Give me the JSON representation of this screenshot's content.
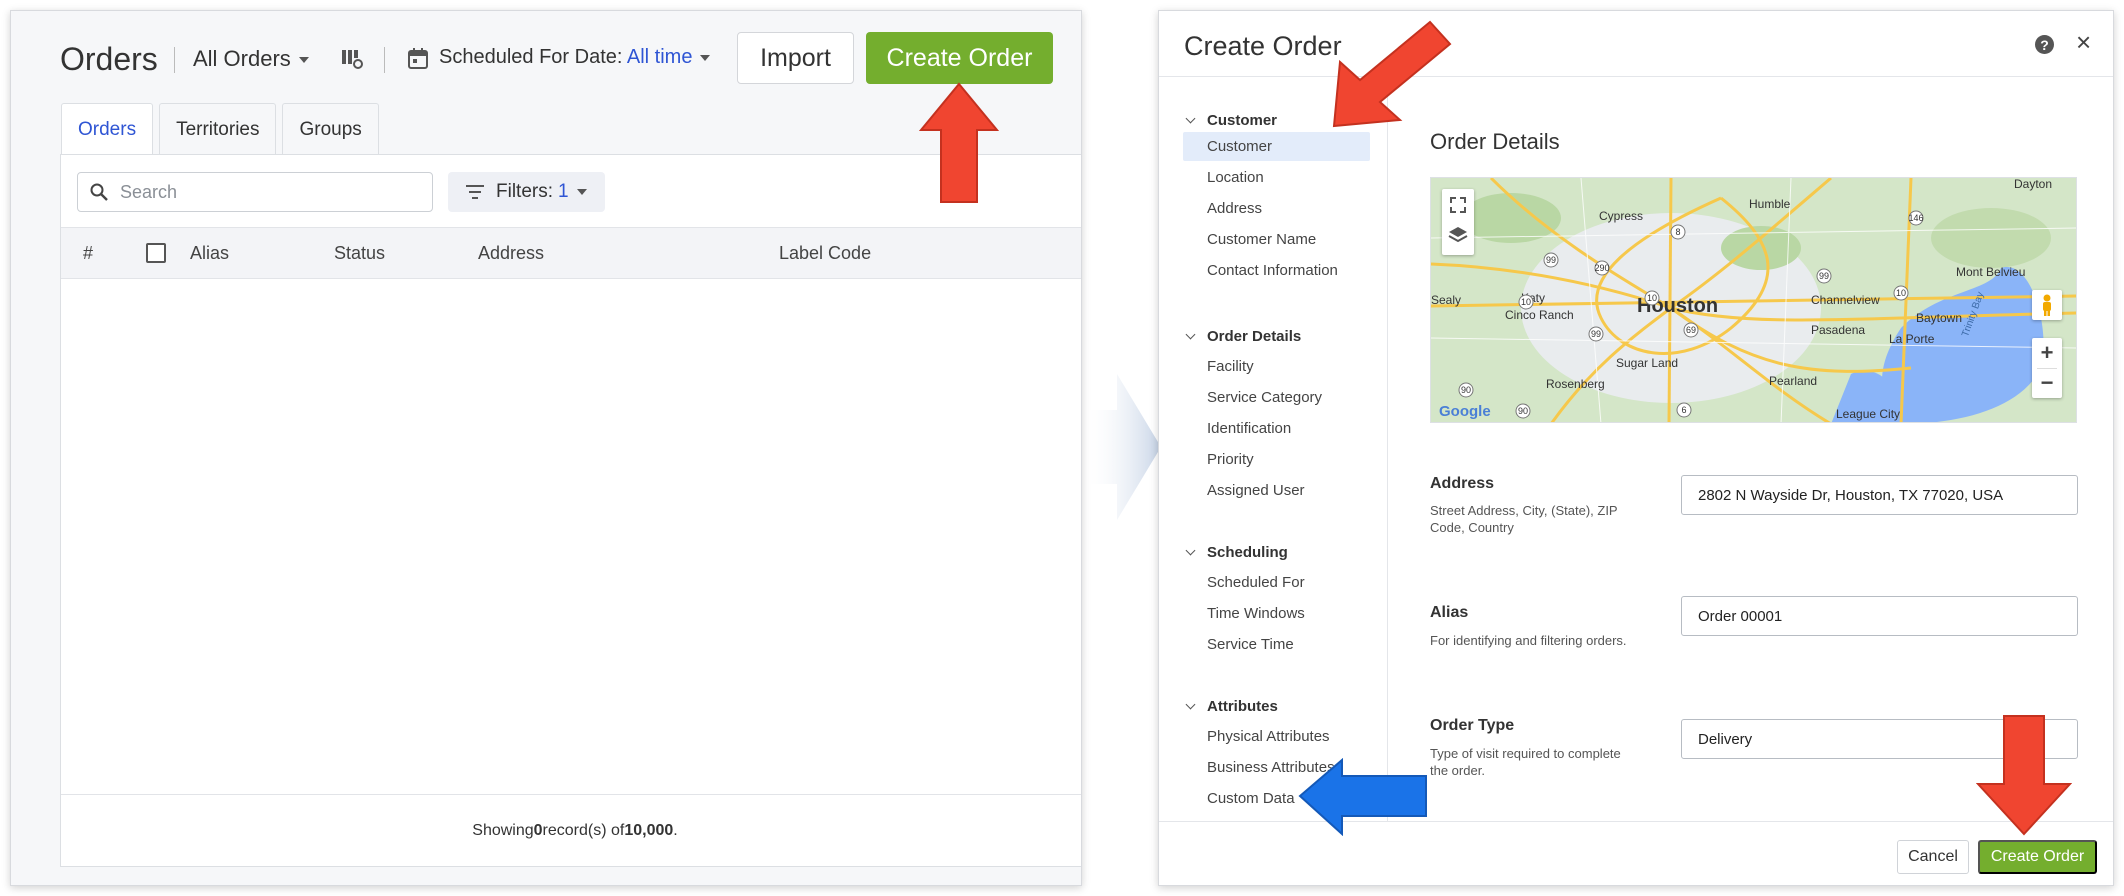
{
  "orders_page": {
    "title": "Orders",
    "view_dropdown": "All Orders",
    "schedule_label": "Scheduled For Date:",
    "schedule_value": "All time",
    "import_label": "Import",
    "create_order_label": "Create Order",
    "tabs": [
      {
        "label": "Orders",
        "active": true
      },
      {
        "label": "Territories",
        "active": false
      },
      {
        "label": "Groups",
        "active": false
      }
    ],
    "search_placeholder": "Search",
    "filters_label": "Filters:",
    "filters_count": "1",
    "columns": [
      "#",
      "Alias",
      "Status",
      "Address",
      "Label Code"
    ],
    "footer": {
      "prefix": "Showing ",
      "count": "0",
      "middle": " record(s) of ",
      "total": "10,000",
      "suffix": "."
    }
  },
  "create_order_panel": {
    "title": "Create Order",
    "nav_groups": [
      {
        "label": "Customer",
        "items": [
          "Customer",
          "Location",
          "Address",
          "Customer Name",
          "Contact Information"
        ]
      },
      {
        "label": "Order Details",
        "items": [
          "Facility",
          "Service Category",
          "Identification",
          "Priority",
          "Assigned User"
        ]
      },
      {
        "label": "Scheduling",
        "items": [
          "Scheduled For",
          "Time Windows",
          "Service Time"
        ]
      },
      {
        "label": "Attributes",
        "items": [
          "Physical Attributes",
          "Business Attributes",
          "Custom Data"
        ]
      }
    ],
    "active_nav_item": "Customer",
    "section_title": "Order Details",
    "map": {
      "labels": [
        "Humble",
        "Dayton",
        "Cypress",
        "Houston",
        "Katy",
        "Channelview",
        "Mont Belvieu",
        "Cinco Ranch",
        "Baytown",
        "Pasadena",
        "La Porte",
        "Sealy",
        "Sugar Land",
        "Rosenberg",
        "Pearland",
        "League City",
        "Trinity Bay",
        "Google"
      ],
      "route_numbers": [
        "8",
        "146",
        "99",
        "290",
        "99",
        "10",
        "10",
        "10",
        "69",
        "99",
        "90",
        "90",
        "6"
      ]
    },
    "fields": [
      {
        "label": "Address",
        "description": "Street Address, City, (State), ZIP Code, Country",
        "value": "2802 N Wayside Dr, Houston, TX 77020, USA"
      },
      {
        "label": "Alias",
        "description": "For identifying and filtering orders.",
        "value": "Order 00001"
      },
      {
        "label": "Order Type",
        "description": "Type of visit required to complete the order.",
        "value": "Delivery"
      }
    ],
    "cancel_label": "Cancel",
    "create_label": "Create Order"
  },
  "colors": {
    "accent_green": "#74ae2e",
    "link_blue": "#2f55d4",
    "arrow_red": "#f04530",
    "arrow_blue": "#1a73e8"
  }
}
